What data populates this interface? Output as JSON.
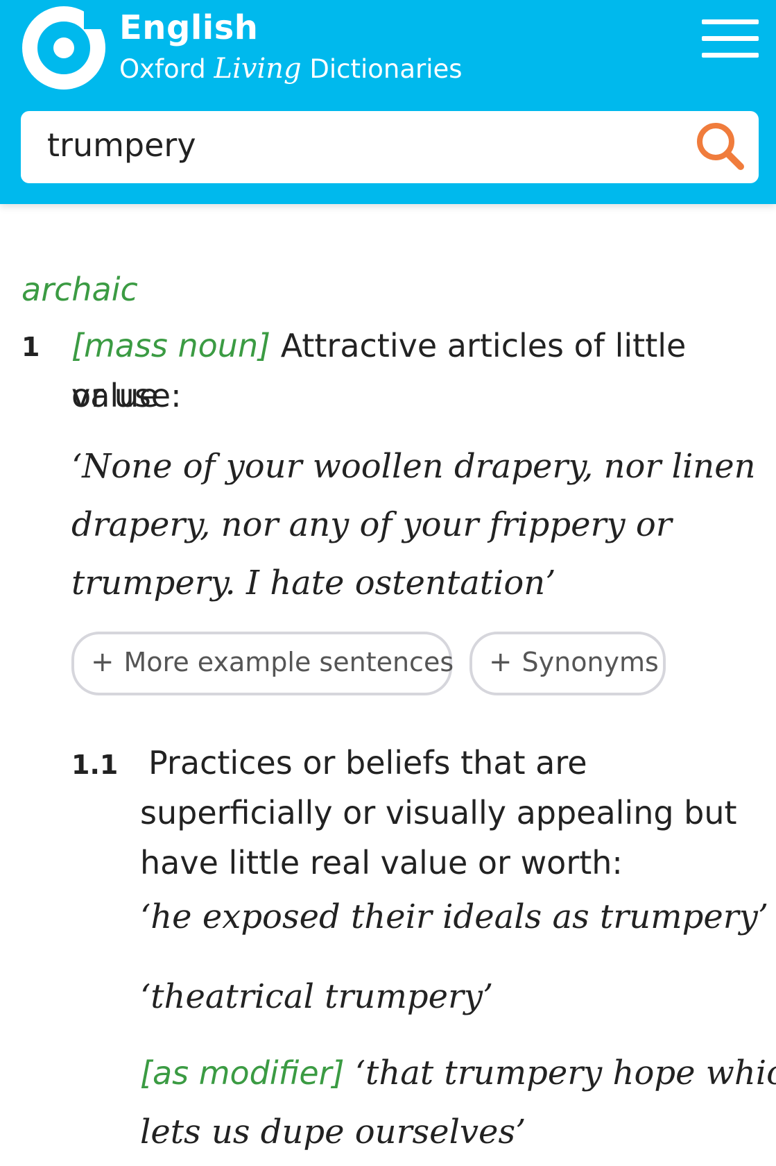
{
  "header": {
    "brand_title": "English",
    "brand_sub_before": "Oxford ",
    "brand_sub_living": "Living",
    "brand_sub_after": " Dictionaries",
    "menu_icon": "hamburger-menu-icon",
    "colors": {
      "header_bg": "#00b9ed",
      "search_icon": "#f07c3c",
      "grammar_green": "#3b9b43"
    }
  },
  "search": {
    "value": "trumpery",
    "icon": "search-icon"
  },
  "entry": {
    "register": "archaic",
    "senses": [
      {
        "number": "1",
        "grammar": "[mass noun]",
        "definition_line1": "Attractive articles of little value",
        "definition_line2": "or use:",
        "example_lines": [
          "‘None of your woollen drapery, nor linen",
          "drapery, nor any of your frippery or",
          "trumpery. I hate ostentation’"
        ],
        "buttons": {
          "more_examples": "More example sentences",
          "synonyms": "Synonyms"
        }
      },
      {
        "number": "1.1",
        "definition_lines": [
          "Practices or beliefs that are",
          "superficially or visually appealing but",
          "have little real value or worth:"
        ],
        "example1": "‘he exposed their ideals as trumpery’",
        "example2": "‘theatrical trumpery’",
        "modifier": "[as modifier]",
        "example3_line1": "‘that trumpery hope which",
        "example3_line2": "lets us dupe ourselves’"
      }
    ]
  }
}
